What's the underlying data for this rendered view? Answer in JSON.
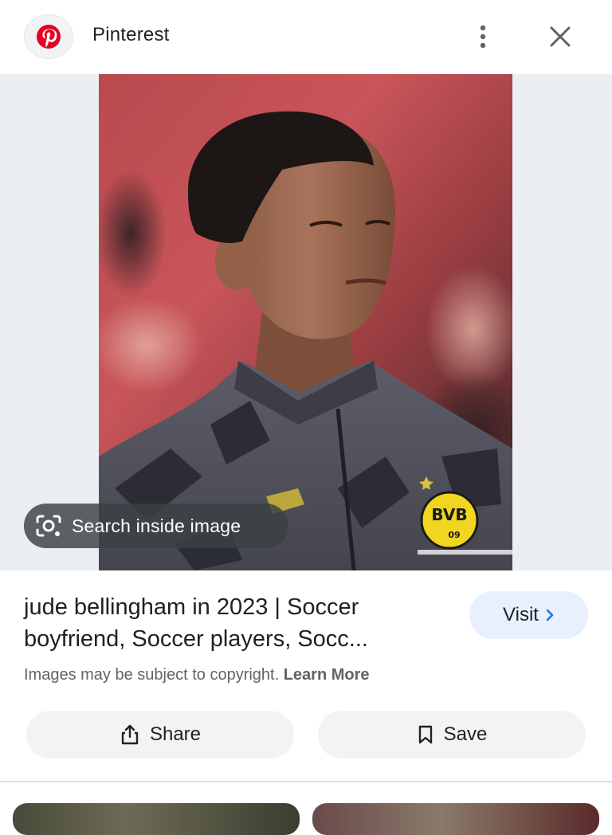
{
  "header": {
    "site_name": "Pinterest",
    "logo_icon": "pinterest-logo-icon",
    "more_icon": "more-vert-icon",
    "close_icon": "close-icon",
    "brand_color": "#e60023"
  },
  "viewer": {
    "search_inside_label": "Search inside image",
    "search_icon": "lens-icon"
  },
  "result": {
    "title_line_1": "jude bellingham in 2023 | Soccer",
    "title_line_2": "boyfriend, Soccer players, Socc...",
    "visit_label": "Visit",
    "visit_icon": "chevron-right-icon",
    "visit_bg": "#e8f0fe"
  },
  "notice": {
    "text": "Images may be subject to copyright.",
    "learn_more": "Learn More"
  },
  "actions": {
    "share_label": "Share",
    "share_icon": "share-icon",
    "save_label": "Save",
    "save_icon": "bookmark-icon"
  }
}
